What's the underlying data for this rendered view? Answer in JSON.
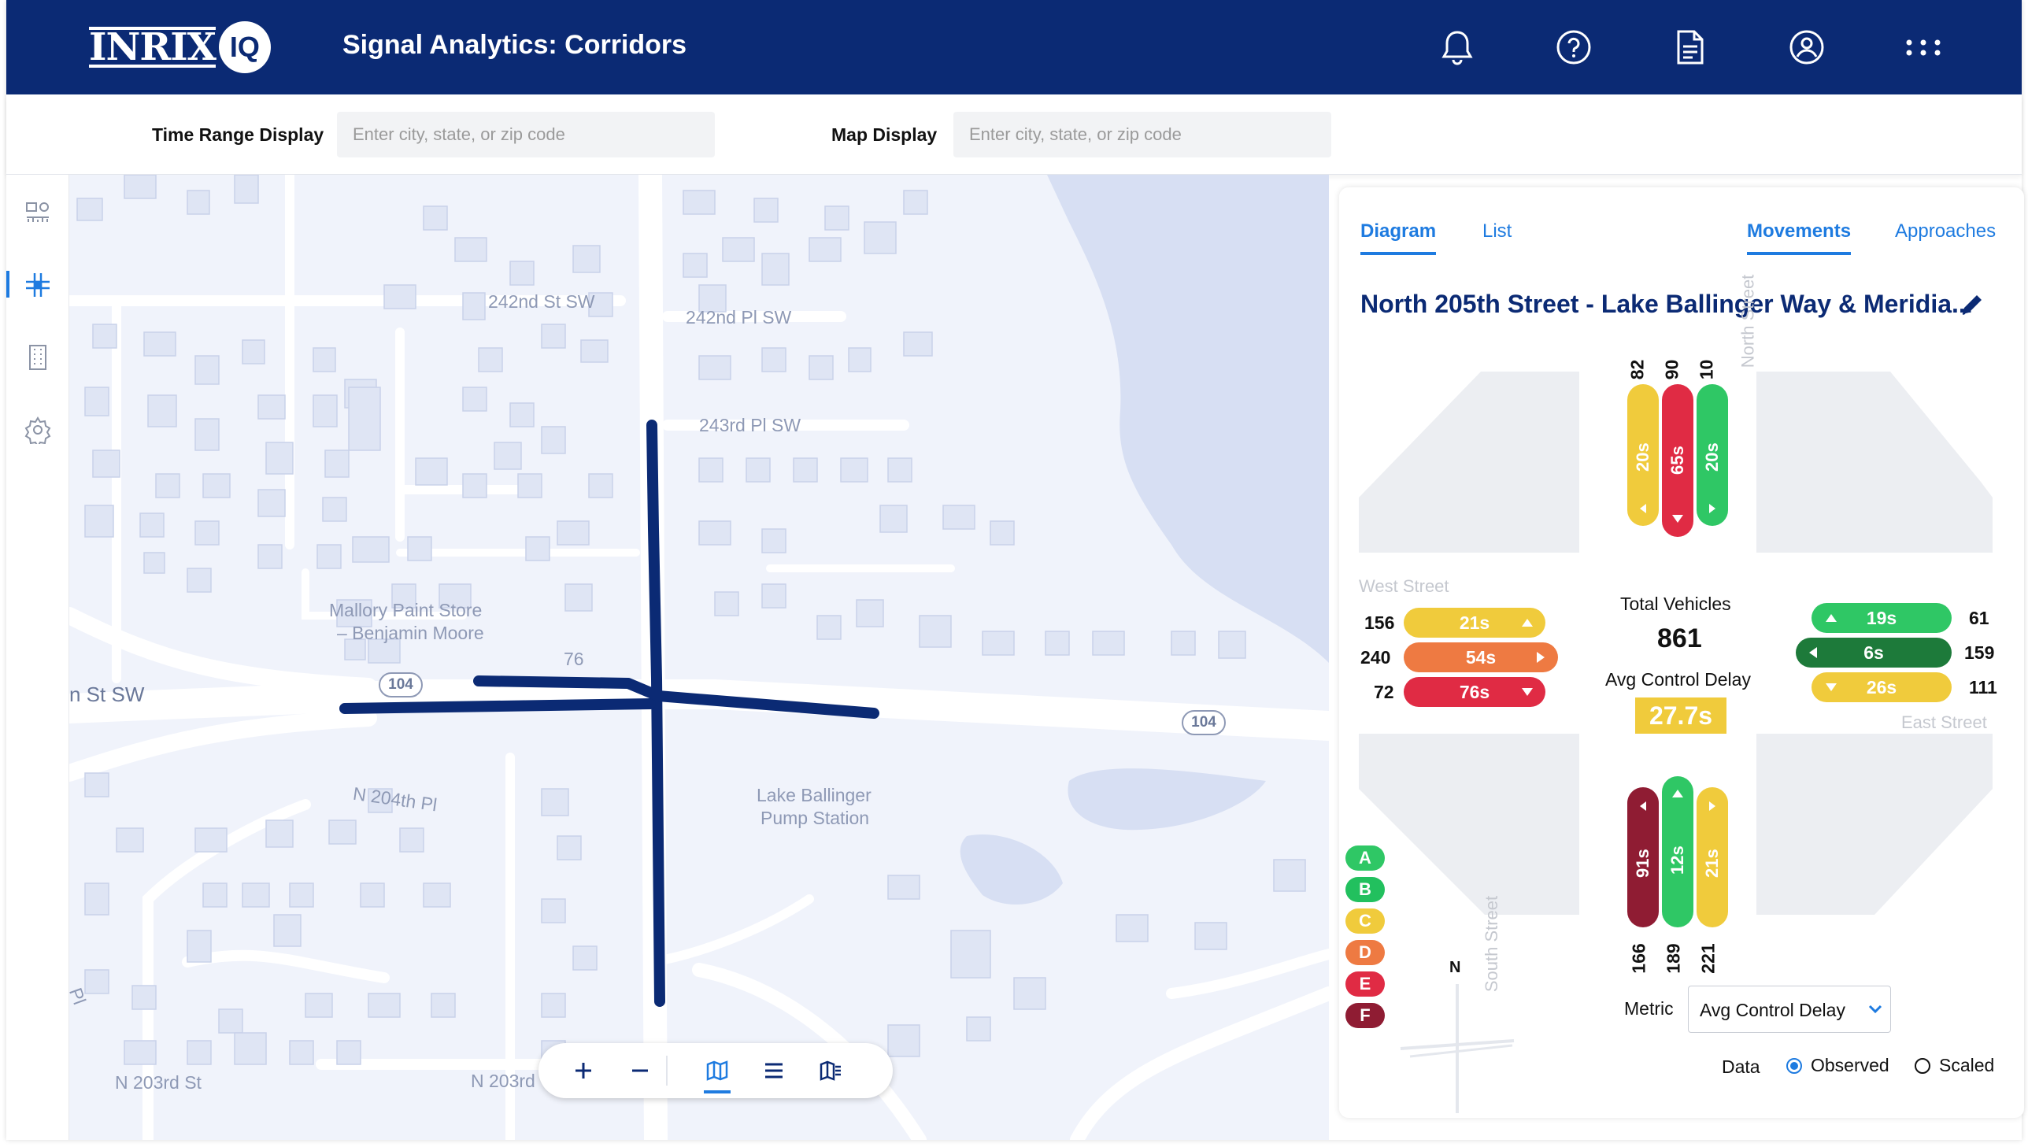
{
  "header": {
    "logo_text": "INRIX",
    "logo_badge": "IQ",
    "title": "Signal Analytics: Corridors"
  },
  "header_icons": [
    "bell-icon",
    "help-icon",
    "report-icon",
    "account-icon",
    "apps-icon"
  ],
  "filters": {
    "time_range": {
      "label": "Time Range Display",
      "placeholder": "Enter city, state, or zip code"
    },
    "map_display": {
      "label": "Map Display",
      "placeholder": "Enter city, state, or zip code"
    }
  },
  "rail_icons": [
    "dashboard-icon",
    "corridor-icon",
    "building-icon",
    "settings-icon"
  ],
  "map": {
    "streets": [
      "242nd St SW",
      "242nd Pl SW",
      "243rd Pl SW",
      "N 204th Pl",
      "N 203rd St",
      "N 203rd",
      "n St SW",
      "Pl"
    ],
    "pois": [
      "Mallory Paint Store",
      "– Benjamin Moore",
      "Lake Ballinger",
      "Pump Station"
    ],
    "shields": [
      "104",
      "104"
    ],
    "other_label": "76",
    "compass": "N"
  },
  "panel": {
    "tabs": {
      "diagram": "Diagram",
      "list": "List",
      "movements": "Movements",
      "approaches": "Approaches"
    },
    "intersection_title": "North 205th Street - Lake Ballinger Way & Meridia...",
    "streets": {
      "north": "North Street",
      "west": "West Street",
      "east": "East Street",
      "south": "South Street"
    },
    "center": {
      "total_label": "Total Vehicles",
      "total_value": "861",
      "delay_label": "Avg Control Delay",
      "delay_value": "27.7s"
    },
    "north": {
      "counts": [
        "82",
        "90",
        "10"
      ],
      "delays": [
        "20s",
        "65s",
        "20s"
      ]
    },
    "south": {
      "counts": [
        "166",
        "189",
        "221"
      ],
      "delays": [
        "91s",
        "12s",
        "21s"
      ]
    },
    "west": {
      "counts": [
        "156",
        "240",
        "72"
      ],
      "delays": [
        "21s",
        "54s",
        "76s"
      ]
    },
    "east": {
      "counts": [
        "61",
        "159",
        "111"
      ],
      "delays": [
        "19s",
        "6s",
        "26s"
      ]
    },
    "grades": [
      "A",
      "B",
      "C",
      "D",
      "E",
      "F"
    ],
    "metric": {
      "label": "Metric",
      "value": "Avg Control Delay"
    },
    "data": {
      "label": "Data",
      "observed": "Observed",
      "scaled": "Scaled"
    }
  },
  "colors": {
    "brand": "#0b2a74",
    "accent": "#1e7be0",
    "A": "#2fc765",
    "B": "#22c05e",
    "C": "#f0cb3c",
    "D": "#ee7a42",
    "E": "#e02b44",
    "F": "#8f1c33",
    "G": "#1d7a3a"
  }
}
